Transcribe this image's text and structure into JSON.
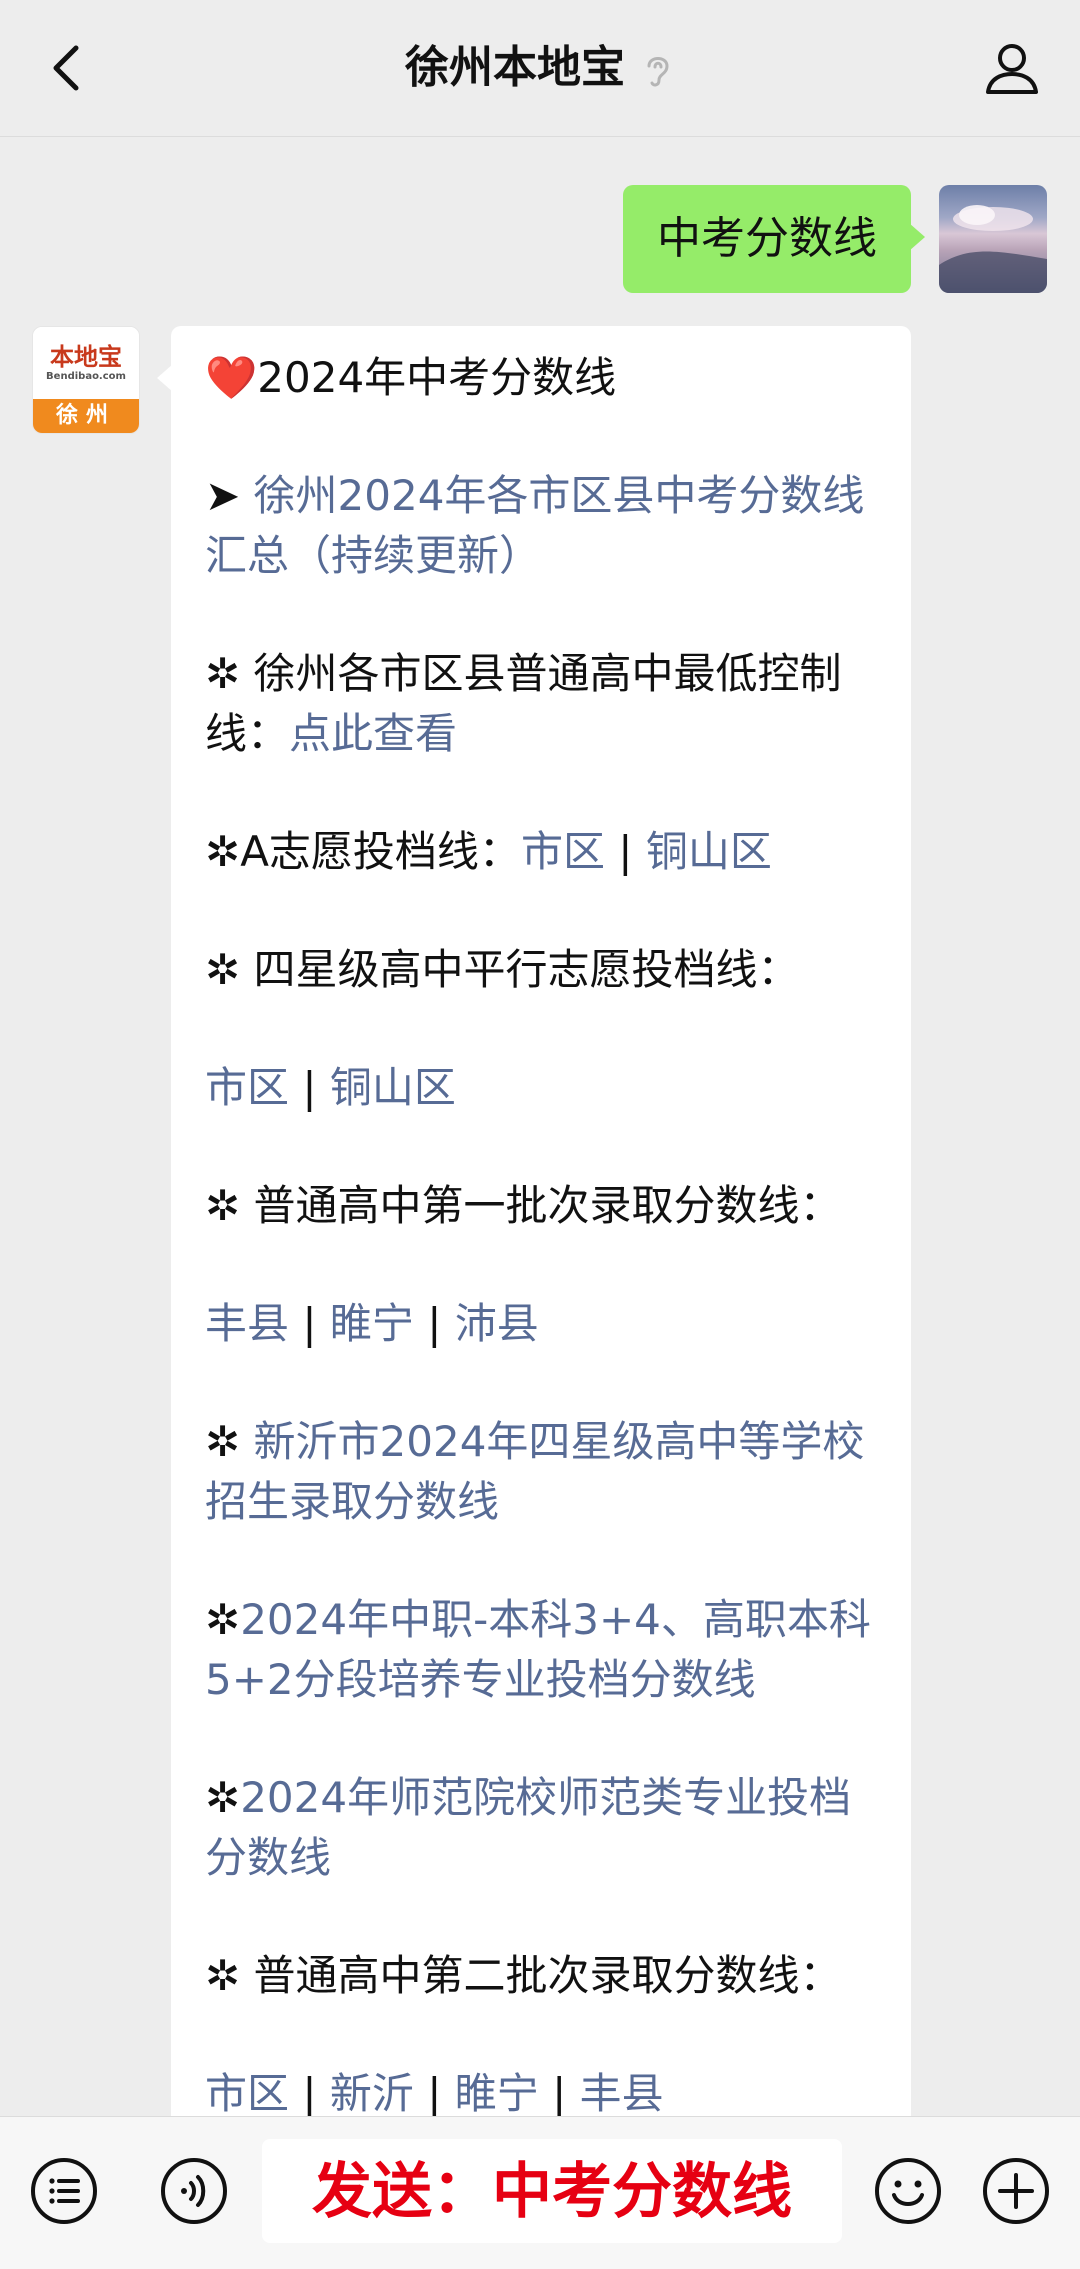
{
  "header": {
    "title": "徐州本地宝"
  },
  "user_message": {
    "text": "中考分数线"
  },
  "bot": {
    "avatar_logo": "本地宝",
    "avatar_sub": "Bendibao.com",
    "avatar_city": "徐州"
  },
  "reply": {
    "heading_emoji": "❤️",
    "heading": "2024年中考分数线",
    "p1_prefix": "➤ ",
    "p1_link": "徐州2024年各市区县中考分数线汇总（持续更新）",
    "p2_prefix": "✲ 徐州各市区县普通高中最低控制线：",
    "p2_link": "点此查看",
    "p3_prefix": "✲A志愿投档线：",
    "p3_link1": "市区",
    "p3_sep1": " | ",
    "p3_link2": "铜山区",
    "p4_text": "✲ 四星级高中平行志愿投档线：",
    "p5_link1": "市区",
    "p5_sep1": " | ",
    "p5_link2": "铜山区",
    "p6_text": "✲ 普通高中第一批次录取分数线：",
    "p7_link1": "丰县",
    "p7_sep1": " |  ",
    "p7_link2": "睢宁",
    "p7_sep2": " | ",
    "p7_link3": "沛县",
    "p8_prefix": "✲ ",
    "p8_link": "新沂市2024年四星级高中等学校招生录取分数线",
    "p9_prefix": "✲",
    "p9_link": "2024年中职-本科3+4、高职本科5+2分段培养专业投档分数线",
    "p10_prefix": "✲",
    "p10_link": "2024年师范院校师范类专业投档分数线",
    "p11_text": "✲ 普通高中第二批次录取分数线：",
    "p12_link1": "市区",
    "p12_sep1": " | ",
    "p12_link2": "新沂",
    "p12_sep2": " | ",
    "p12_link3": "睢宁",
    "p12_sep3": " | ",
    "p12_link4": "丰县"
  },
  "input": {
    "text": "发送：中考分数线"
  },
  "icons": {
    "back": "chevron-left-icon",
    "ear": "ear-icon",
    "profile": "person-icon",
    "menu": "list-menu-icon",
    "voice": "voice-icon",
    "emoji": "smile-icon",
    "plus": "plus-icon"
  },
  "colors": {
    "user_bubble": "#95ec69",
    "link": "#576b95",
    "input_text": "#e60012",
    "avatar_orange": "#f08a1e"
  }
}
